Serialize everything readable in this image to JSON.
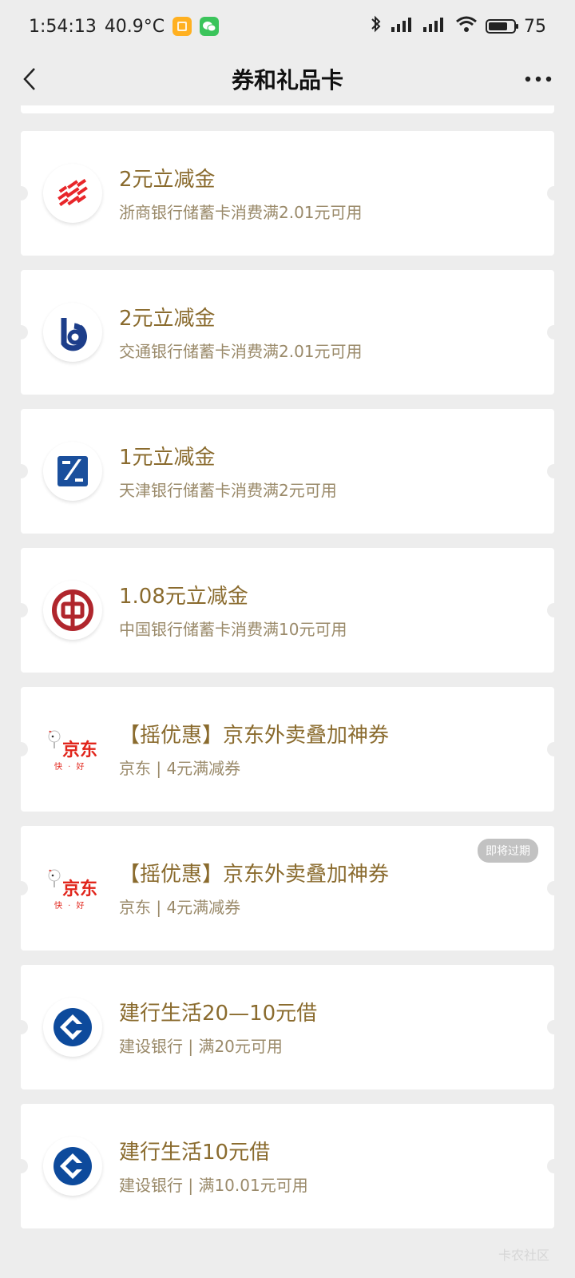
{
  "status": {
    "time": "1:54:13",
    "temperature": "40.9°C",
    "battery": "75",
    "battery_level": 0.75
  },
  "header": {
    "title": "券和礼品卡"
  },
  "cards": [
    {
      "title": "2元立减金",
      "subtitle": "浙商银行储蓄卡消费满2.01元可用",
      "logo_icon": "czbank-logo-icon"
    },
    {
      "title": "2元立减金",
      "subtitle": "交通银行储蓄卡消费满2.01元可用",
      "logo_icon": "bankcomm-logo-icon"
    },
    {
      "title": "1元立减金",
      "subtitle": "天津银行储蓄卡消费满2元可用",
      "logo_icon": "bank-of-tianjin-logo-icon"
    },
    {
      "title": "1.08元立减金",
      "subtitle": "中国银行储蓄卡消费满10元可用",
      "logo_icon": "bank-of-china-logo-icon"
    },
    {
      "title": "【摇优惠】京东外卖叠加神券",
      "subtitle": "京东 | 4元满减券",
      "logo_icon": "jd-logo-icon",
      "logo_text": "京东",
      "logo_subtext": "快 · 好"
    },
    {
      "title": "【摇优惠】京东外卖叠加神券",
      "subtitle": "京东 | 4元满减券",
      "logo_icon": "jd-logo-icon",
      "logo_text": "京东",
      "logo_subtext": "快 · 好",
      "badge": "即将过期"
    },
    {
      "title": "建行生活20—10元借",
      "subtitle": "建设银行 | 满20元可用",
      "logo_icon": "ccb-logo-icon"
    },
    {
      "title": "建行生活10元借",
      "subtitle": "建设银行 | 满10.01元可用",
      "logo_icon": "ccb-logo-icon"
    }
  ],
  "watermark": "卡农社区",
  "colors": {
    "title": "#8a6b2e",
    "subtitle": "#9a8a6a",
    "czbank": "#e8262a",
    "bankcomm": "#1d3e8a",
    "tianjin": "#1a4f9c",
    "boc": "#b0262d",
    "jd": "#e1251b",
    "ccb": "#0d4a9c"
  }
}
